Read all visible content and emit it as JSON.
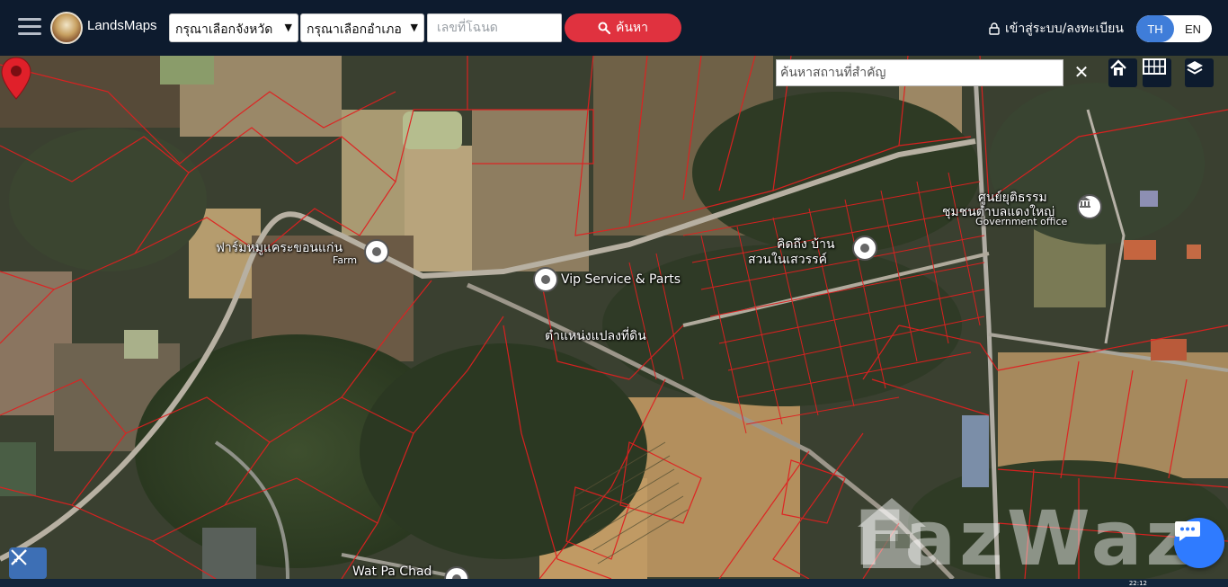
{
  "header": {
    "brand": "LandsMaps",
    "province_select": "กรุณาเลือกจังหวัด",
    "district_select": "กรุณาเลือกอำเภอ",
    "deed_placeholder": "เลขที่โฉนด",
    "search_label": "ค้นหา",
    "login_label": "เข้าสู่ระบบ/ลงทะเบียน",
    "lang_th": "TH",
    "lang_en": "EN",
    "accent_color": "#e0323f",
    "lang_active_color": "#3f7dd9"
  },
  "map": {
    "place_search_placeholder": "ค้นหาสถานที่สำคัญ",
    "clear_symbol": "✕",
    "controls": [
      "home-icon",
      "grid-icon",
      "layers-icon"
    ],
    "labels": {
      "farm_th": "ฟาร์มหมูแคระขอนแก่น",
      "farm_en": "Farm",
      "vip": "Vip Service & Parts",
      "parcel": "ตำแหน่งแปลงที่ดิน",
      "village_line1": "คิดถึง บ้าน",
      "village_line2": "สวนในเสวรรค์",
      "gov_line1": "ศูนย์ยุติธรรม",
      "gov_line2": "ชุมชนตำบลแดงใหญ่",
      "gov_en": "Government office",
      "temple": "Wat Pa Chad"
    },
    "parcel_line_color": "#e02020",
    "pin_color": "#e0202a"
  },
  "watermark": "FazWaz",
  "taskbar_time": "22:12"
}
